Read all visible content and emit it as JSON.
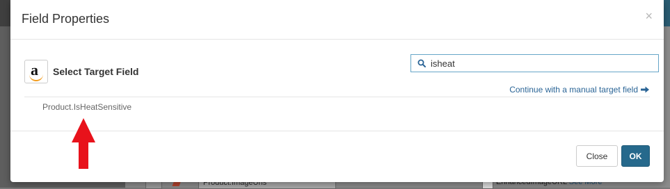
{
  "modal": {
    "title": "Field Properties",
    "close_glyph": "×",
    "target_section": {
      "logo_letter": "a",
      "label": "Select Target Field"
    },
    "search": {
      "value": "isheat",
      "icon": "search-icon"
    },
    "manual_link": "Continue with a manual target field",
    "results": [
      "Product.IsHeatSensitive"
    ],
    "buttons": {
      "close": "Close",
      "ok": "OK"
    }
  },
  "background": {
    "field_value": "Product.ImageUrls",
    "target_value": "EnhancedImageURL",
    "see_more": "See More"
  },
  "colors": {
    "primary": "#26698c",
    "link": "#2a6496",
    "annotation": "#e8121b",
    "amazon_smile": "#f29d20"
  }
}
